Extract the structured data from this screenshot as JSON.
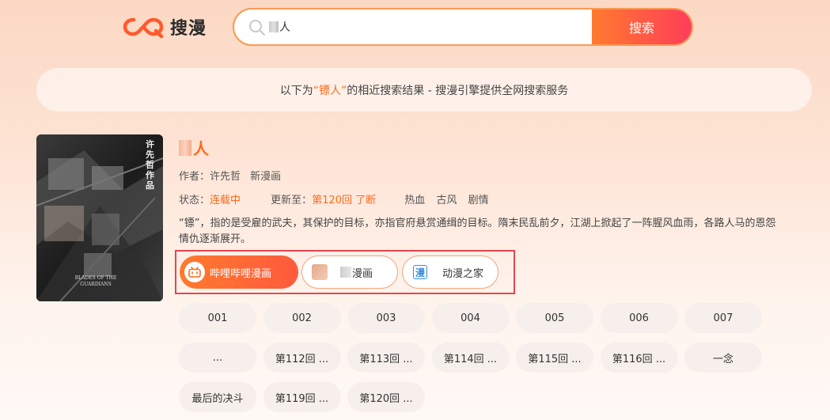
{
  "header": {
    "logo_text": "搜漫",
    "search_query_visible": "人",
    "search_button": "搜索"
  },
  "notice": {
    "prefix": "以下为",
    "keyword": "“镖人”",
    "suffix": "的相近搜索结果 - 搜漫引擎提供全网搜索服务"
  },
  "comic": {
    "title_visible": "人",
    "author_label": "作者：",
    "author": "许先哲",
    "publisher": "新漫画",
    "status_label": "状态：",
    "status": "连载中",
    "update_label": "更新至：",
    "update": "第120回 了断",
    "tags": [
      "热血",
      "古风",
      "剧情"
    ],
    "description": "“镖”，指的是受雇的武夫，其保护的目标，亦指官府悬赏通缉的目标。隋末民乱前夕，江湖上掀起了一阵腥风血雨，各路人马的恩怨情仇逐渐展开。",
    "cover_text_top": "许先哲 作品",
    "cover_text_bottom": "BLADES OF THE GUARDIANS"
  },
  "sources": [
    {
      "label": "哔哩哔哩漫画",
      "icon": "bilibili-icon",
      "active": true
    },
    {
      "label": "漫画",
      "icon": "blurred-source-icon",
      "active": false
    },
    {
      "label": "动漫之家",
      "icon": "dmzj-icon",
      "icon_glyph": "漫",
      "active": false
    }
  ],
  "chapters": [
    "001",
    "002",
    "003",
    "004",
    "005",
    "006",
    "007",
    "...",
    "第112回 ...",
    "第113回 ...",
    "第114回 ...",
    "第115回 ...",
    "第116回 ...",
    "一念",
    "最后的决斗",
    "第119回 ...",
    "第120回 ..."
  ],
  "colors": {
    "accent": "#ff6a1a",
    "button_gradient_start": "#ff7a2e",
    "button_gradient_end": "#ff3d5a",
    "highlight_box": "#e5454e"
  }
}
